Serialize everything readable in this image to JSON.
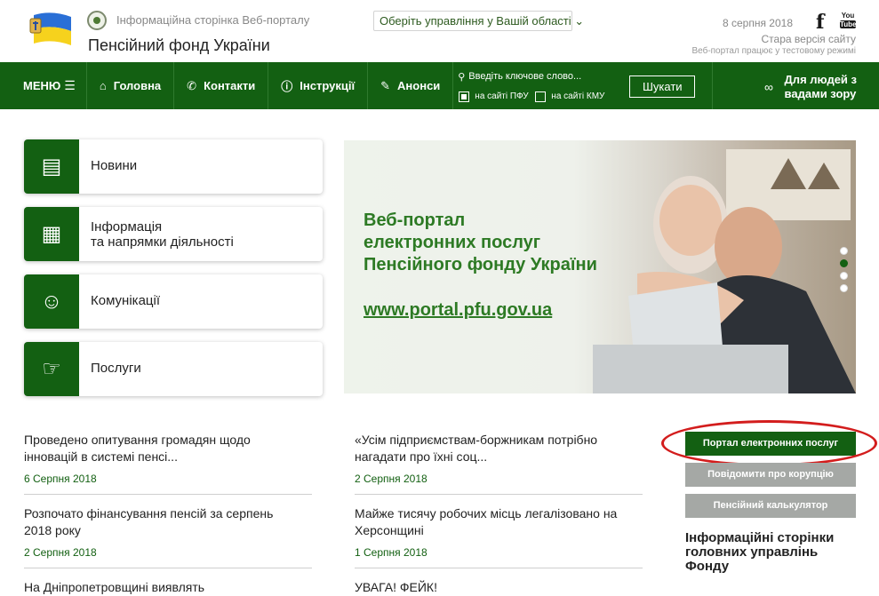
{
  "header": {
    "portal_subtitle": "Інформаційна сторінка Веб-порталу",
    "portal_title": "Пенсійний фонд України",
    "region_select": "Оберіть управління у Вашій області",
    "date": "8 серпня 2018",
    "old_version": "Стара версія сайту",
    "test_mode": "Веб-портал працює у тестовому режимі",
    "social": {
      "facebook": "f",
      "youtube_top": "You",
      "youtube_bottom": "Tube"
    }
  },
  "nav": {
    "menu": "МЕНЮ",
    "home": "Головна",
    "contacts": "Контакти",
    "instructions": "Інструкції",
    "announcements": "Анонси",
    "search_placeholder": "Введіть ключове слово...",
    "on_pfu": "на сайті ПФУ",
    "on_kmu": "на сайті КМУ",
    "search_button": "Шукати",
    "vision_line1": "Для людей з",
    "vision_line2": "вадами зору",
    "icons": {
      "home": "home-icon",
      "contacts": "phone-icon",
      "instructions": "info-icon",
      "announcements": "megaphone-icon",
      "search": "search-icon",
      "vision": "glasses-icon"
    }
  },
  "categories": [
    {
      "line1": "Новини",
      "line2": ""
    },
    {
      "line1": "Інформація",
      "line2": "та напрямки діяльності"
    },
    {
      "line1": "Комунікації",
      "line2": ""
    },
    {
      "line1": "Послуги",
      "line2": ""
    }
  ],
  "banner": {
    "line1": "Веб-портал",
    "line2": "електронних послуг",
    "line3": "Пенсійного фонду України",
    "link": "www.portal.pfu.gov.ua"
  },
  "news_left": [
    {
      "line1": "Проведено опитування громадян щодо",
      "line2": "інновацій в системі пенсі...",
      "date": "6 Серпня 2018"
    },
    {
      "line1": "Розпочато фінансування пенсій за серпень",
      "line2": "2018 року",
      "date": "2 Серпня 2018"
    },
    {
      "line1": "На Дніпропетровщині виявлять",
      "line2": "",
      "date": ""
    }
  ],
  "news_right": [
    {
      "line1": "«Усім підприємствам-боржникам потрібно",
      "line2": "нагадати про їхні соц...",
      "date": "2 Серпня 2018"
    },
    {
      "line1": "Майже тисячу робочих місць легалізовано на",
      "line2": "Херсонщині",
      "date": "1 Серпня 2018"
    },
    {
      "line1": "УВАГА! ФЕЙК!",
      "line2": "",
      "date": ""
    }
  ],
  "sidebar": {
    "portal_button": "Портал електронних послуг",
    "corruption_button": "Повідомити про корупцію",
    "calculator_button": "Пенсійний калькулятор",
    "heading_line1": "Інформаційні сторінки",
    "heading_line2": "головних управлінь",
    "heading_line3": "Фонду"
  }
}
